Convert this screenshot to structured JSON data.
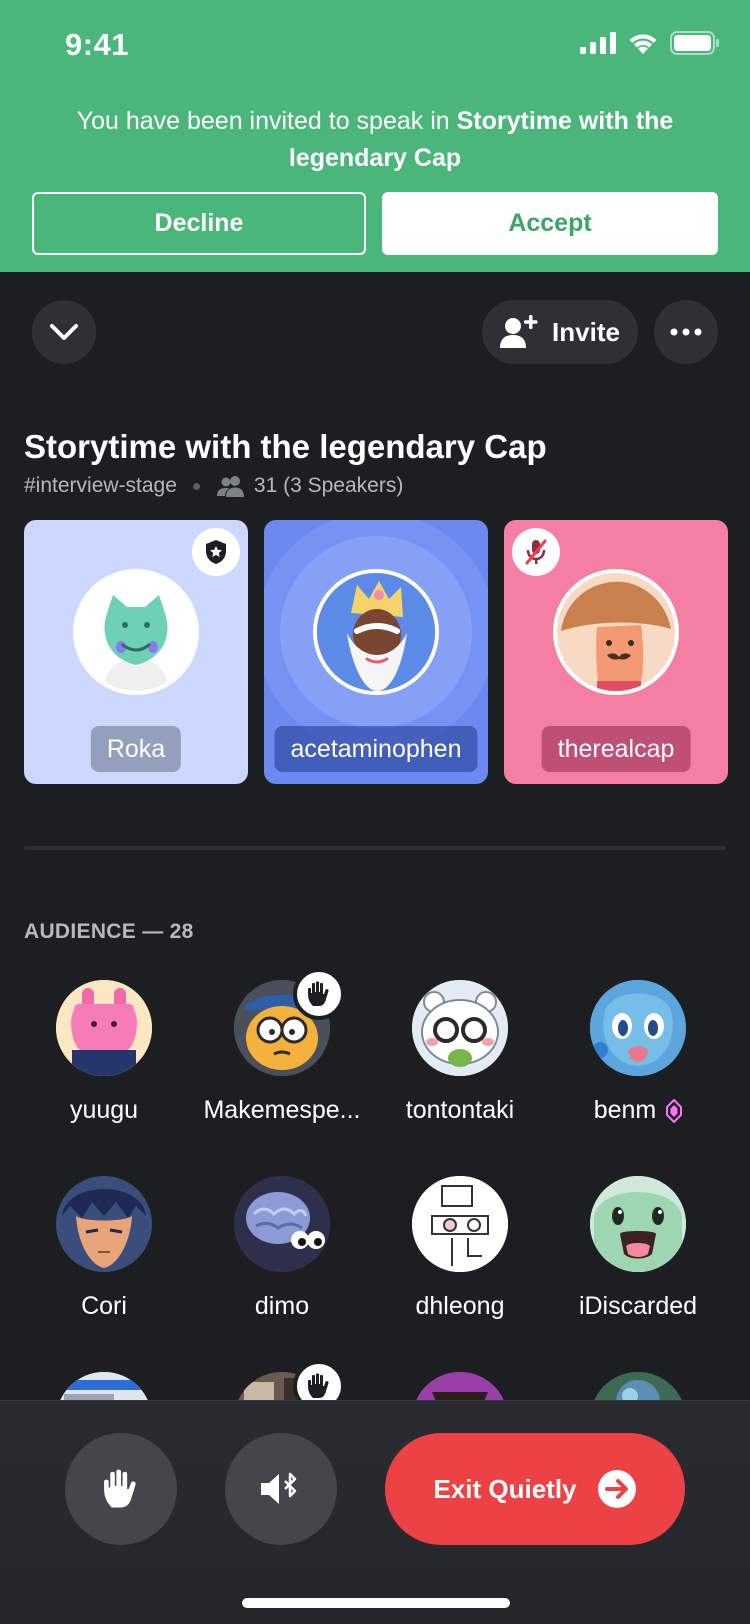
{
  "status_bar": {
    "time": "9:41"
  },
  "invite_banner": {
    "text_prefix": "You have been invited to speak in ",
    "stage_name": "Storytime with the legendary Cap",
    "decline_label": "Decline",
    "accept_label": "Accept"
  },
  "top_controls": {
    "invite_label": "Invite"
  },
  "stage": {
    "title": "Storytime with the legendary Cap",
    "channel": "#interview-stage",
    "listener_count": "31 (3 Speakers)"
  },
  "speakers": [
    {
      "name": "Roka",
      "card_color": "#cdd8ff",
      "badge": "moderator-shield-icon"
    },
    {
      "name": "acetaminophen",
      "card_color": "#6a8af2",
      "badge": ""
    },
    {
      "name": "therealcap",
      "card_color": "#f47fa3",
      "badge": "muted-mic-icon"
    }
  ],
  "audience": {
    "header": "AUDIENCE — 28",
    "members": [
      {
        "name": "yuugu",
        "hand_raised": false
      },
      {
        "name": "Makemespe...",
        "hand_raised": true
      },
      {
        "name": "tontontaki",
        "hand_raised": false
      },
      {
        "name": "benm",
        "hand_raised": false,
        "badge": "nitro-gem-icon"
      },
      {
        "name": "Cori",
        "hand_raised": false
      },
      {
        "name": "dimo",
        "hand_raised": false
      },
      {
        "name": "dhleong",
        "hand_raised": false
      },
      {
        "name": "iDiscarded",
        "hand_raised": false
      },
      {
        "name": "",
        "hand_raised": false
      },
      {
        "name": "",
        "hand_raised": true
      },
      {
        "name": "",
        "hand_raised": false
      },
      {
        "name": "",
        "hand_raised": false
      }
    ]
  },
  "bottom_bar": {
    "exit_label": "Exit Quietly"
  },
  "colors": {
    "banner_green": "#4bb67c",
    "exit_red": "#ed4245",
    "nitro_pink": "#ff73fa"
  }
}
